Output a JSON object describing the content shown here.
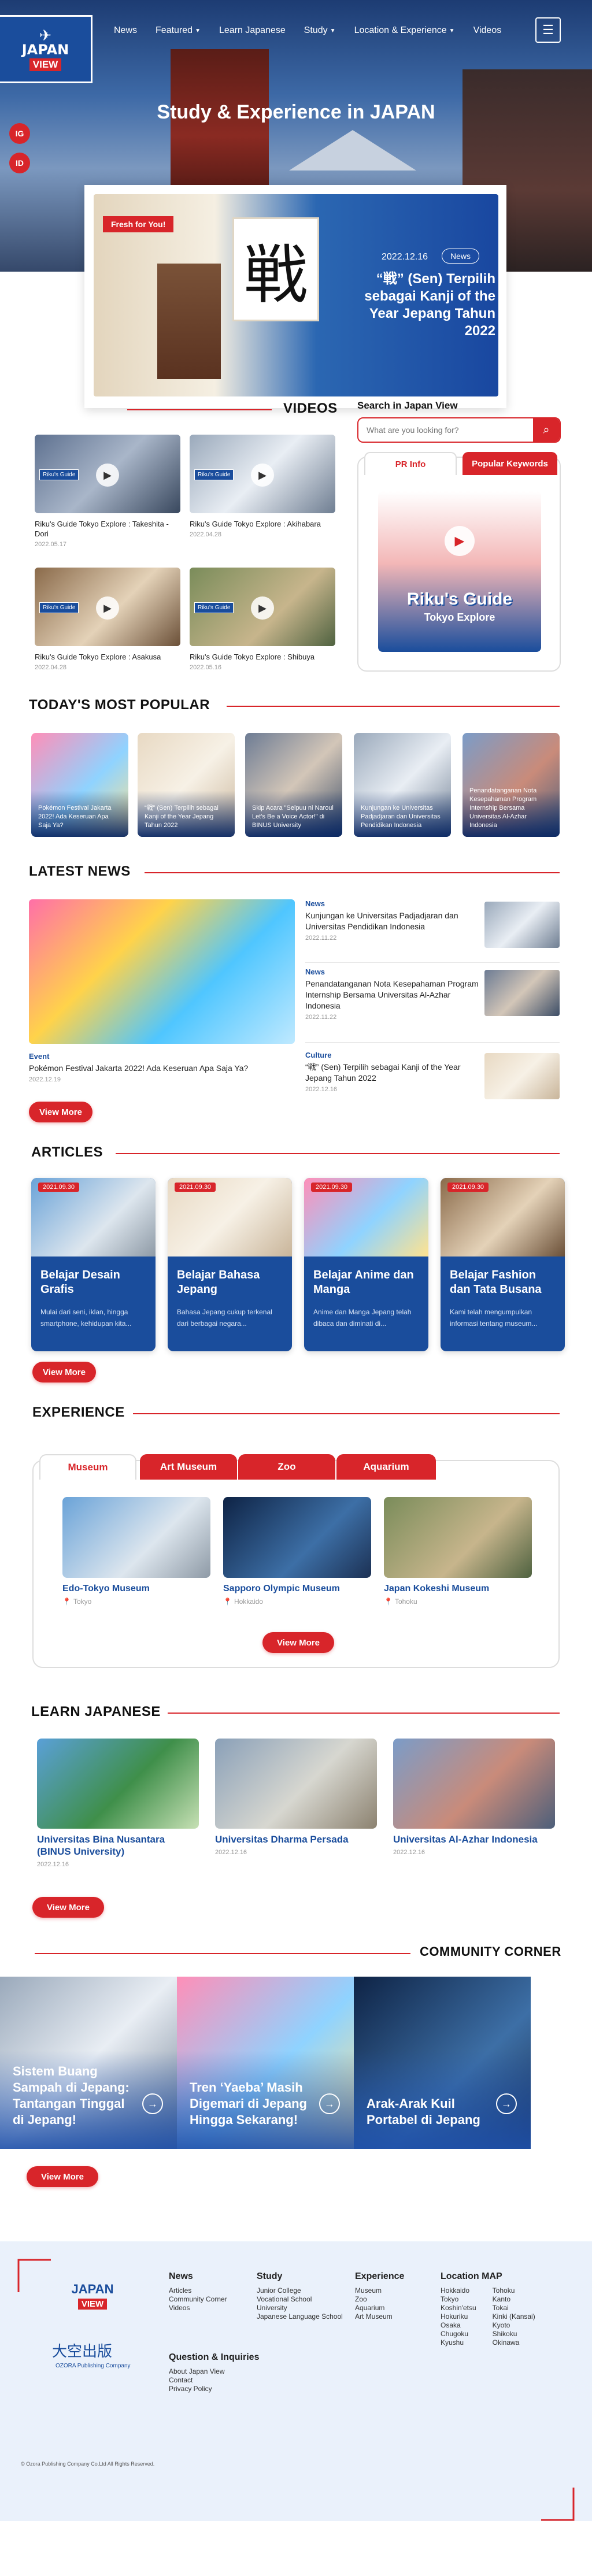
{
  "header": {
    "logo_line1": "JAPAN",
    "logo_line2": "VIEW",
    "nav": [
      {
        "label": "News",
        "caret": false
      },
      {
        "label": "Featured",
        "caret": true
      },
      {
        "label": "Learn Japanese",
        "caret": false
      },
      {
        "label": "Study",
        "caret": true
      },
      {
        "label": "Location & Experience",
        "caret": true
      },
      {
        "label": "Videos",
        "caret": false
      }
    ],
    "menu_icon": "hamburger-icon",
    "social": [
      "IG",
      "ID"
    ],
    "hero_title": "Study & Experience in JAPAN"
  },
  "feature": {
    "tag": "Fresh for You!",
    "date": "2022.12.16",
    "badge": "News",
    "title": "“戦” (Sen) Terpilih sebagai Kanji of the Year Jepang Tahun 2022",
    "kanji": "戦"
  },
  "videos": {
    "title": "VIDEOS",
    "items": [
      {
        "title": "Riku's Guide Tokyo Explore : Takeshita -Dori",
        "date": "2022.05.17",
        "tag": "Riku's Guide"
      },
      {
        "title": "Riku's Guide Tokyo Explore : Akihabara",
        "date": "2022.04.28",
        "tag": "Riku's Guide"
      },
      {
        "title": "Riku's Guide Tokyo Explore : Asakusa",
        "date": "2022.04.28",
        "tag": "Riku's Guide"
      },
      {
        "title": "Riku's Guide Tokyo Explore : Shibuya",
        "date": "2022.05.16",
        "tag": "Riku's Guide"
      }
    ]
  },
  "search": {
    "label": "Search in Japan View",
    "placeholder": "What are you looking for?",
    "icon": "search-icon"
  },
  "pr": {
    "tab_active": "PR Info",
    "tab_other": "Popular Keywords",
    "brand_line1": "Riku's Guide",
    "brand_line2": "Tokyo Explore"
  },
  "popular": {
    "title": "TODAY'S MOST POPULAR",
    "items": [
      {
        "title": "Pokémon Festival Jakarta 2022! Ada Keseruan Apa Saja Ya?"
      },
      {
        "title": "“戦” (Sen) Terpilih sebagai Kanji of the Year Jepang Tahun 2022"
      },
      {
        "title": "Skip Acara \"Selpuu ni Naroul Let's Be a Voice Actor!\" di BINUS University"
      },
      {
        "title": "Kunjungan ke Universitas Padjadjaran dan Universitas Pendidikan Indonesia"
      },
      {
        "title": "Penandatanganan Nota Kesepahaman Program Internship Bersama Universitas Al-Azhar Indonesia"
      }
    ]
  },
  "latest": {
    "title": "LATEST NEWS",
    "main": {
      "category": "Event",
      "title": "Pokémon Festival Jakarta 2022! Ada Keseruan Apa Saja Ya?",
      "date": "2022.12.19"
    },
    "items": [
      {
        "category": "News",
        "title": "Kunjungan ke Universitas Padjadjaran dan Universitas Pendidikan Indonesia",
        "date": "2022.11.22"
      },
      {
        "category": "News",
        "title": "Penandatanganan Nota Kesepahaman Program Internship Bersama Universitas Al-Azhar Indonesia",
        "date": "2022.11.22"
      },
      {
        "category": "Culture",
        "title": "“戦” (Sen) Terpilih sebagai Kanji of the Year Jepang Tahun 2022",
        "date": "2022.12.16"
      }
    ],
    "view_more": "View More"
  },
  "articles": {
    "title": "ARTICLES",
    "items": [
      {
        "date": "2021.09.30",
        "title": "Belajar Desain Grafis",
        "desc": "Mulai dari seni, iklan, hingga smartphone, kehidupan kita..."
      },
      {
        "date": "2021.09.30",
        "title": "Belajar Bahasa Jepang",
        "desc": "Bahasa Jepang cukup terkenal dari berbagai negara..."
      },
      {
        "date": "2021.09.30",
        "title": "Belajar Anime dan Manga",
        "desc": "Anime dan Manga Jepang telah dibaca dan diminati di..."
      },
      {
        "date": "2021.09.30",
        "title": "Belajar Fashion dan Tata Busana",
        "desc": "Kami telah mengumpulkan informasi tentang museum..."
      }
    ],
    "view_more": "View More"
  },
  "experience": {
    "title": "EXPERIENCE",
    "tabs": [
      "Museum",
      "Art Museum",
      "Zoo",
      "Aquarium"
    ],
    "items": [
      {
        "title": "Edo-Tokyo Museum",
        "location": "Tokyo"
      },
      {
        "title": "Sapporo Olympic Museum",
        "location": "Hokkaido"
      },
      {
        "title": "Japan Kokeshi Museum",
        "location": "Tohoku"
      }
    ],
    "view_more": "View More"
  },
  "learn": {
    "title": "LEARN JAPANESE",
    "items": [
      {
        "title": "Universitas Bina Nusantara (BINUS University)",
        "date": "2022.12.16"
      },
      {
        "title": "Universitas Dharma Persada",
        "date": "2022.12.16"
      },
      {
        "title": "Universitas Al-Azhar Indonesia",
        "date": "2022.12.16"
      }
    ],
    "view_more": "View More"
  },
  "community": {
    "title": "COMMUNITY CORNER",
    "items": [
      {
        "title": "Sistem Buang Sampah di Jepang: Tantangan Tinggal di Jepang!"
      },
      {
        "title": "Tren ‘Yaeba’ Masih Digemari di Jepang Hingga Sekarang!"
      },
      {
        "title": "Arak-Arak Kuil Portabel di Jepang"
      }
    ],
    "view_more": "View More"
  },
  "footer": {
    "publisher": "大空出版",
    "publisher_en": "OZORA Publishing Company",
    "columns": [
      {
        "head": "News",
        "items": [
          "Articles",
          "Community Corner",
          "Videos"
        ]
      },
      {
        "head": "Study",
        "items": [
          "Junior College",
          "Vocational School",
          "University",
          "Japanese Language School"
        ]
      },
      {
        "head": "Experience",
        "items": [
          "Museum",
          "Zoo",
          "Aquarium",
          "Art Museum"
        ]
      },
      {
        "head": "Location MAP",
        "items": [
          "Hokkaido",
          "Tokyo",
          "Koshin'etsu",
          "Hokuriku",
          "Osaka",
          "Chugoku",
          "Kyushu"
        ],
        "items2": [
          "Tohoku",
          "Kanto",
          "Tokai",
          "Kinki (Kansai)",
          "Kyoto",
          "Shikoku",
          "Okinawa"
        ]
      }
    ],
    "qa_head": "Question & Inquiries",
    "qa_items": [
      "About Japan View",
      "Contact",
      "Privacy Policy"
    ],
    "copyright": "© Ozora Publishing Company Co.Ltd All Rights Reserved."
  },
  "colors": {
    "accent": "#d8252a",
    "brand": "#1a4d9c"
  }
}
